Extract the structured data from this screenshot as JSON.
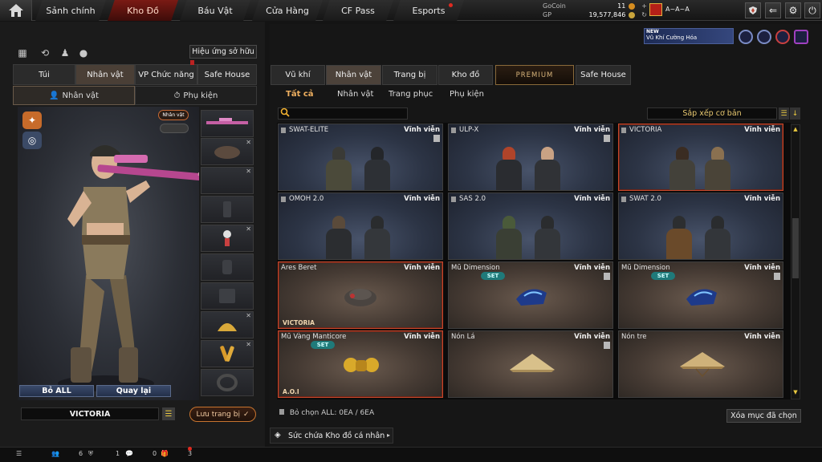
{
  "nav": {
    "tabs": [
      {
        "label": "Sảnh chính"
      },
      {
        "label": "Kho Đồ"
      },
      {
        "label": "Báu Vật"
      },
      {
        "label": "Cửa Hàng"
      },
      {
        "label": "CF Pass"
      },
      {
        "label": "Esports"
      }
    ],
    "active_index": 1
  },
  "currency": {
    "gocoin_label": "GoCoin",
    "gocoin_value": "11",
    "gp_label": "GP",
    "gp_value": "19,577,846"
  },
  "player": {
    "name": "A~A~A"
  },
  "left": {
    "ownership_effect": "Hiệu ứng sở hữu",
    "tabs": [
      "Túi",
      "Nhân vật",
      "VP Chức năng",
      "Safe House"
    ],
    "subtabs": [
      "Nhân vật",
      "Phụ kiện"
    ],
    "character_badge": "Nhân vật",
    "remove_all": "Bỏ ALL",
    "back": "Quay lại",
    "character_name": "VICTORIA",
    "save_outfit": "Lưu trang bị"
  },
  "promo": {
    "badge": "NEW",
    "text": "Vũ Khí Cường Hóa"
  },
  "right": {
    "tabs": [
      "Vũ khí",
      "Nhân vật",
      "Trang bị",
      "Kho đồ",
      "PREMIUM",
      "Safe House"
    ],
    "subtabs": [
      "Tất cả",
      "Nhân vật",
      "Trang phục",
      "Phụ kiện"
    ],
    "sort_label": "Sắp xếp cơ bản",
    "deselect_all": "Bỏ chọn ALL: 0EA / 6EA",
    "clear_selected": "Xóa mục đã chọn",
    "expand_inventory": "Sức chứa Kho đồ cá nhân"
  },
  "items": [
    {
      "name": "SWAT-ELITE",
      "duration": "Vĩnh viễn",
      "pin": true
    },
    {
      "name": "ULP-X",
      "duration": "Vĩnh viễn",
      "pin": true
    },
    {
      "name": "VICTORIA",
      "duration": "Vĩnh viễn",
      "pin": true
    },
    {
      "name": "OMOH 2.0",
      "duration": "Vĩnh viễn",
      "pin": true
    },
    {
      "name": "SAS 2.0",
      "duration": "Vĩnh viễn",
      "pin": true
    },
    {
      "name": "SWAT 2.0",
      "duration": "Vĩnh viễn",
      "pin": true
    },
    {
      "name": "Ares Beret",
      "duration": "Vĩnh viễn",
      "tag": "VICTORIA"
    },
    {
      "name": "Mũ Dimension",
      "duration": "Vĩnh viễn",
      "set": "SET"
    },
    {
      "name": "Mũ Dimension",
      "duration": "Vĩnh viễn",
      "set": "SET"
    },
    {
      "name": "Mũ Vàng Manticore",
      "duration": "Vĩnh viễn",
      "set": "SET",
      "tag": "A.O.I"
    },
    {
      "name": "Nón Lá",
      "duration": "Vĩnh viễn"
    },
    {
      "name": "Nón tre",
      "duration": "Vĩnh viễn"
    }
  ],
  "bottom": {
    "count1": "6",
    "count2": "1",
    "count3": "0",
    "count4": "3"
  },
  "colors": {
    "accent": "#c96a33",
    "active_tab": "#7a1a14",
    "selected_border": "#c7482c"
  }
}
